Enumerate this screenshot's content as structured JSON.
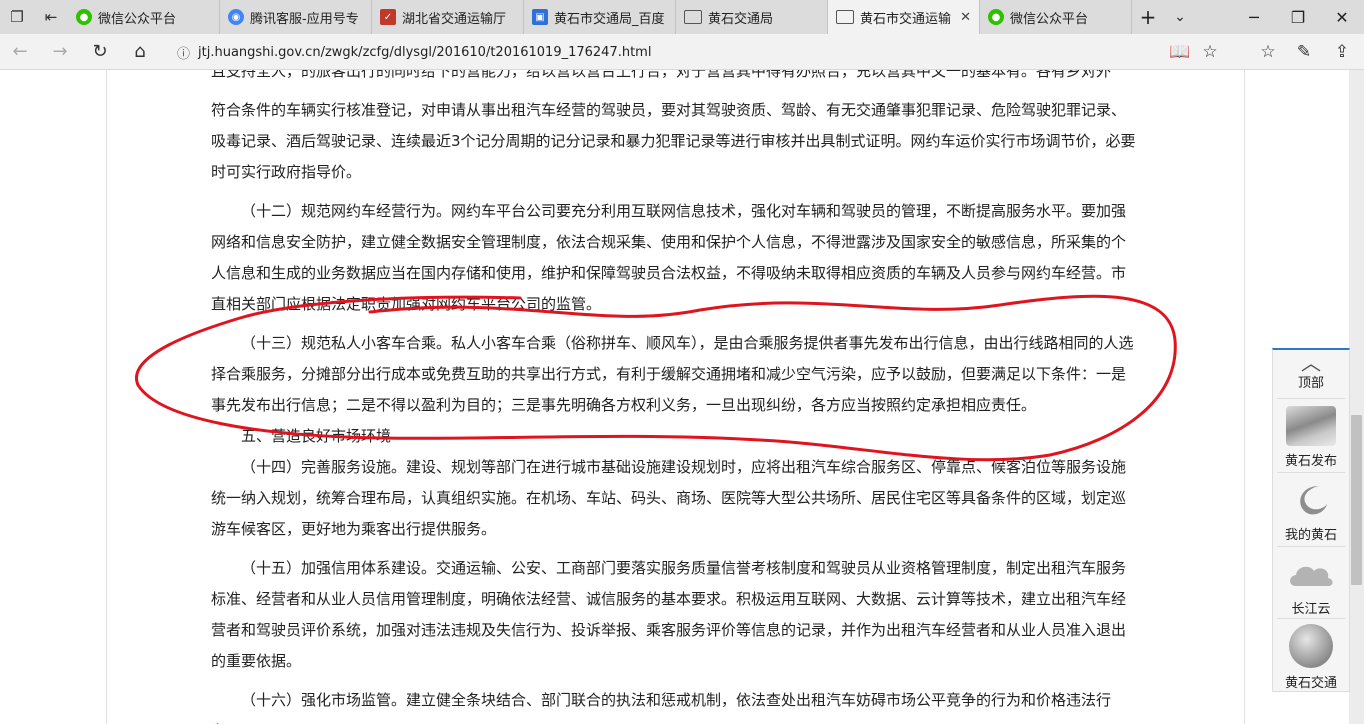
{
  "tabs": [
    {
      "title": "微信公众平台",
      "icon": "wechat-icon",
      "color": "#2dc100",
      "active": false
    },
    {
      "title": "腾讯客服-应用号专",
      "icon": "chrome-icon",
      "color": "#4285f4",
      "active": false
    },
    {
      "title": "湖北省交通运输厅",
      "icon": "news-icon",
      "color": "#c0392b",
      "active": false
    },
    {
      "title": "黄石市交通局_百度",
      "icon": "baidu-icon",
      "color": "#2f6fd6",
      "active": false
    },
    {
      "title": "黄石交通局",
      "icon": "page-icon",
      "color": "#555555",
      "active": false
    },
    {
      "title": "黄石市交通运输",
      "icon": "page-icon",
      "color": "#555555",
      "active": true
    },
    {
      "title": "微信公众平台",
      "icon": "wechat-icon",
      "color": "#2dc100",
      "active": false
    }
  ],
  "url": "jtj.huangshi.gov.cn/zwgk/zcfg/dlysgl/201610/t20161019_176247.html",
  "article": {
    "paragraphs": [
      "且支持全人，的旅客出行的同时给下的营能力，给以营以营台上行合，对于营营其中得有办照合，充以营其中文一的基本有。各有乡对外",
      "符合条件的车辆实行核准登记，对申请从事出租汽车经营的驾驶员，要对其驾驶资质、驾龄、有无交通肇事犯罪记录、危险驾驶犯罪记录、吸毒记录、酒后驾驶记录、连续最近3个记分周期的记分记录和暴力犯罪记录等进行审核并出具制式证明。网约车运价实行市场调节价，必要时可实行政府指导价。",
      "（十二）规范网约车经营行为。网约车平台公司要充分利用互联网信息技术，强化对车辆和驾驶员的管理，不断提高服务水平。要加强网络和信息安全防护，建立健全数据安全管理制度，依法合规采集、使用和保护个人信息，不得泄露涉及国家安全的敏感信息，所采集的个人信息和生成的业务数据应当在国内存储和使用，维护和保障驾驶员合法权益，不得吸纳未取得相应资质的车辆及人员参与网约车经营。市直相关部门应根据法定职责加强对网约车平台公司的监管。",
      "（十三）规范私人小客车合乘。私人小客车合乘（俗称拼车、顺风车），是由合乘服务提供者事先发布出行信息，由出行线路相同的人选择合乘服务，分摊部分出行成本或免费互助的共享出行方式，有利于缓解交通拥堵和减少空气污染，应予以鼓励，但要满足以下条件：一是事先发布出行信息；二是不得以盈利为目的；三是事先明确各方权利义务，一旦出现纠纷，各方应当按照约定承担相应责任。",
      "五、营造良好市场环境",
      "（十四）完善服务设施。建设、规划等部门在进行城市基础设施建设规划时，应将出租汽车综合服务区、停靠点、候客泊位等服务设施统一纳入规划，统筹合理布局，认真组织实施。在机场、车站、码头、商场、医院等大型公共场所、居民住宅区等具备条件的区域，划定巡游车候客区，更好地为乘客出行提供服务。",
      "（十五）加强信用体系建设。交通运输、公安、工商部门要落实服务质量信誉考核制度和驾驶员从业资格管理制度，制定出租汽车服务标准、经营者和从业人员信用管理制度，明确依法经营、诚信服务的基本要求。积极运用互联网、大数据、云计算等技术，建立出租汽车经营者和驾驶员评价系统，加强对违法违规及失信行为、投诉举报、乘客服务评价等信息的记录，并作为出租汽车经营者和从业人员准入退出的重要依据。",
      "（十六）强化市场监管。建立健全条块结合、部门联合的执法和惩戒机制，依法查处出租汽车妨碍市场公平竞争的行为和价格违法行为。"
    ]
  },
  "side_panel": {
    "top_label": "顶部",
    "items": [
      {
        "label": "黄石发布",
        "icon": "huangshi-release-icon"
      },
      {
        "label": "我的黄石",
        "icon": "my-huangshi-icon"
      },
      {
        "label": "长江云",
        "icon": "changjiang-cloud-icon"
      },
      {
        "label": "黄石交通",
        "icon": "huangshi-traffic-icon"
      }
    ]
  },
  "colors": {
    "annotation": "#e0141e",
    "accent": "#2f78c4"
  }
}
